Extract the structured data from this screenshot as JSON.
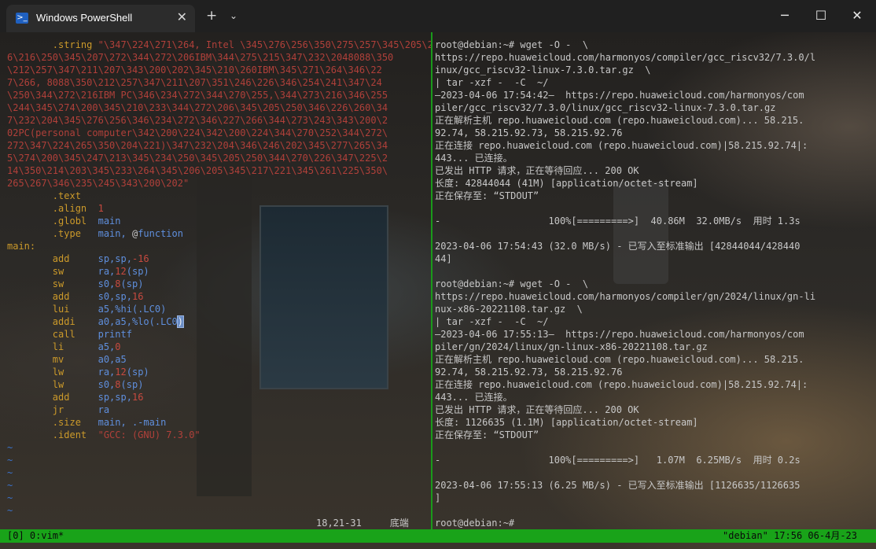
{
  "window": {
    "tab_icon": "powershell-icon",
    "tab_title": "Windows PowerShell",
    "close_glyph": "✕",
    "new_tab_glyph": "+",
    "dropdown_glyph": "⌄",
    "minimize_glyph": "─",
    "maximize_glyph": "☐",
    "window_close_glyph": "✕"
  },
  "vim": {
    "string_lines": [
      "\\345\\276\\256\\350\\275\\257\\345\\205\\254\\345\\217\\270\\34",
      "6\\216\\250\\345\\207\\272\\344\\272\\206IBM\\344\\275\\215\\347\\232\\2048088\\350",
      "\\212\\257\\347\\211\\207\\343\\200\\202\\345\\210\\260IBM\\345\\271\\264\\346\\22",
      "7\\266, 8088\\350\\212\\257\\347\\211\\207\\351\\246\\226\\346\\254\\241\\347\\24",
      "\\250\\344\\272\\216IBM PC\\346\\234\\272\\344\\270\\255,\\344\\273\\216\\346\\255",
      "\\244\\345\\274\\200\\345\\210\\233\\344\\272\\206\\345\\205\\250\\346\\226\\260\\34",
      "7\\232\\204\\345\\276\\256\\346\\234\\272\\346\\227\\266\\344\\273\\243\\343\\200\\2",
      "02PC(personal computer\\342\\200\\224\\342\\200\\224\\344\\270\\252\\344\\272\\",
      "272\\347\\224\\265\\350\\204\\221)\\347\\232\\204\\346\\246\\202\\345\\277\\265\\34",
      "5\\274\\200\\345\\247\\213\\345\\234\\250\\345\\205\\250\\344\\270\\226\\347\\225\\2",
      "14\\350\\214\\203\\345\\233\\264\\345\\206\\205\\345\\217\\221\\345\\261\\225\\350\\",
      "265\\267\\346\\235\\245\\343\\200\\202\""
    ],
    "lines": [
      {
        "t": "        ",
        "k": ".string",
        "rest": " \"\\347\\224\\271\\264, Intel"
      },
      {
        "t": "",
        "k": ".text",
        "rest": ""
      },
      {
        "t": "",
        "k": ".align",
        "rest": "  1"
      },
      {
        "t": "",
        "k": ".globl",
        "rest": "  main"
      },
      {
        "t": "",
        "k": ".type",
        "rest": "   main, @function"
      }
    ],
    "label_main": "main:",
    "asm": [
      {
        "op": "add",
        "a1": "sp,sp,",
        "n": "-16",
        "a2": ""
      },
      {
        "op": "sw",
        "a1": "ra,",
        "n": "12",
        "a2": "(sp)"
      },
      {
        "op": "sw",
        "a1": "s0,",
        "n": "8",
        "a2": "(sp)"
      },
      {
        "op": "add",
        "a1": "s0,sp,",
        "n": "16",
        "a2": ""
      },
      {
        "op": "lui",
        "a1": "a5,%hi(.LC0)",
        "n": "",
        "a2": ""
      },
      {
        "op": "addi",
        "a1": "a0,a5,%lo(.LC0",
        "n": "",
        "a2": ")"
      },
      {
        "op": "call",
        "a1": "printf",
        "n": "",
        "a2": ""
      },
      {
        "op": "li",
        "a1": "a5,",
        "n": "0",
        "a2": ""
      },
      {
        "op": "mv",
        "a1": "a0,a5",
        "n": "",
        "a2": ""
      },
      {
        "op": "lw",
        "a1": "ra,",
        "n": "12",
        "a2": "(sp)"
      },
      {
        "op": "lw",
        "a1": "s0,",
        "n": "8",
        "a2": "(sp)"
      },
      {
        "op": "add",
        "a1": "sp,sp,",
        "n": "16",
        "a2": ""
      },
      {
        "op": "jr",
        "a1": "ra",
        "n": "",
        "a2": ""
      }
    ],
    "size_dir": ".size",
    "size_arg": "main, .-main",
    "ident_dir": ".ident",
    "ident_arg": "\"GCC: (GNU) 7.3.0\"",
    "tilde": "~",
    "position": "18,21-31",
    "position_label": "底端"
  },
  "shell": {
    "lines": [
      "root@debian:~# wget -O -  \\",
      "https://repo.huaweicloud.com/harmonyos/compiler/gcc_riscv32/7.3.0/l",
      "inux/gcc_riscv32-linux-7.3.0.tar.gz  \\",
      "| tar -xzf -  -C  ~/",
      "—2023-04-06 17:54:42—  https://repo.huaweicloud.com/harmonyos/com",
      "piler/gcc_riscv32/7.3.0/linux/gcc_riscv32-linux-7.3.0.tar.gz",
      "正在解析主机 repo.huaweicloud.com (repo.huaweicloud.com)... 58.215.",
      "92.74, 58.215.92.73, 58.215.92.76",
      "正在连接 repo.huaweicloud.com (repo.huaweicloud.com)|58.215.92.74|:",
      "443... 已连接。",
      "已发出 HTTP 请求，正在等待回应... 200 OK",
      "长度: 42844044 (41M) [application/octet-stream]",
      "正在保存至: “STDOUT”",
      "",
      "-                   100%[=========>]  40.86M  32.0MB/s  用时 1.3s",
      "",
      "2023-04-06 17:54:43 (32.0 MB/s) - 已写入至标准输出 [42844044/428440",
      "44]",
      "",
      "root@debian:~# wget -O -  \\",
      "https://repo.huaweicloud.com/harmonyos/compiler/gn/2024/linux/gn-li",
      "nux-x86-20221108.tar.gz  \\",
      "| tar -xzf -  -C  ~/",
      "—2023-04-06 17:55:13—  https://repo.huaweicloud.com/harmonyos/com",
      "piler/gn/2024/linux/gn-linux-x86-20221108.tar.gz",
      "正在解析主机 repo.huaweicloud.com (repo.huaweicloud.com)... 58.215.",
      "92.74, 58.215.92.73, 58.215.92.76",
      "正在连接 repo.huaweicloud.com (repo.huaweicloud.com)|58.215.92.74|:",
      "443... 已连接。",
      "已发出 HTTP 请求，正在等待回应... 200 OK",
      "长度: 1126635 (1.1M) [application/octet-stream]",
      "正在保存至: “STDOUT”",
      "",
      "-                   100%[=========>]   1.07M  6.25MB/s  用时 0.2s",
      "",
      "2023-04-06 17:55:13 (6.25 MB/s) - 已写入至标准输出 [1126635/1126635",
      "]",
      "",
      "root@debian:~# "
    ]
  },
  "tmux": {
    "left": "[0] 0:vim*",
    "right": "\"debian\" 17:56 06-4月-23"
  }
}
